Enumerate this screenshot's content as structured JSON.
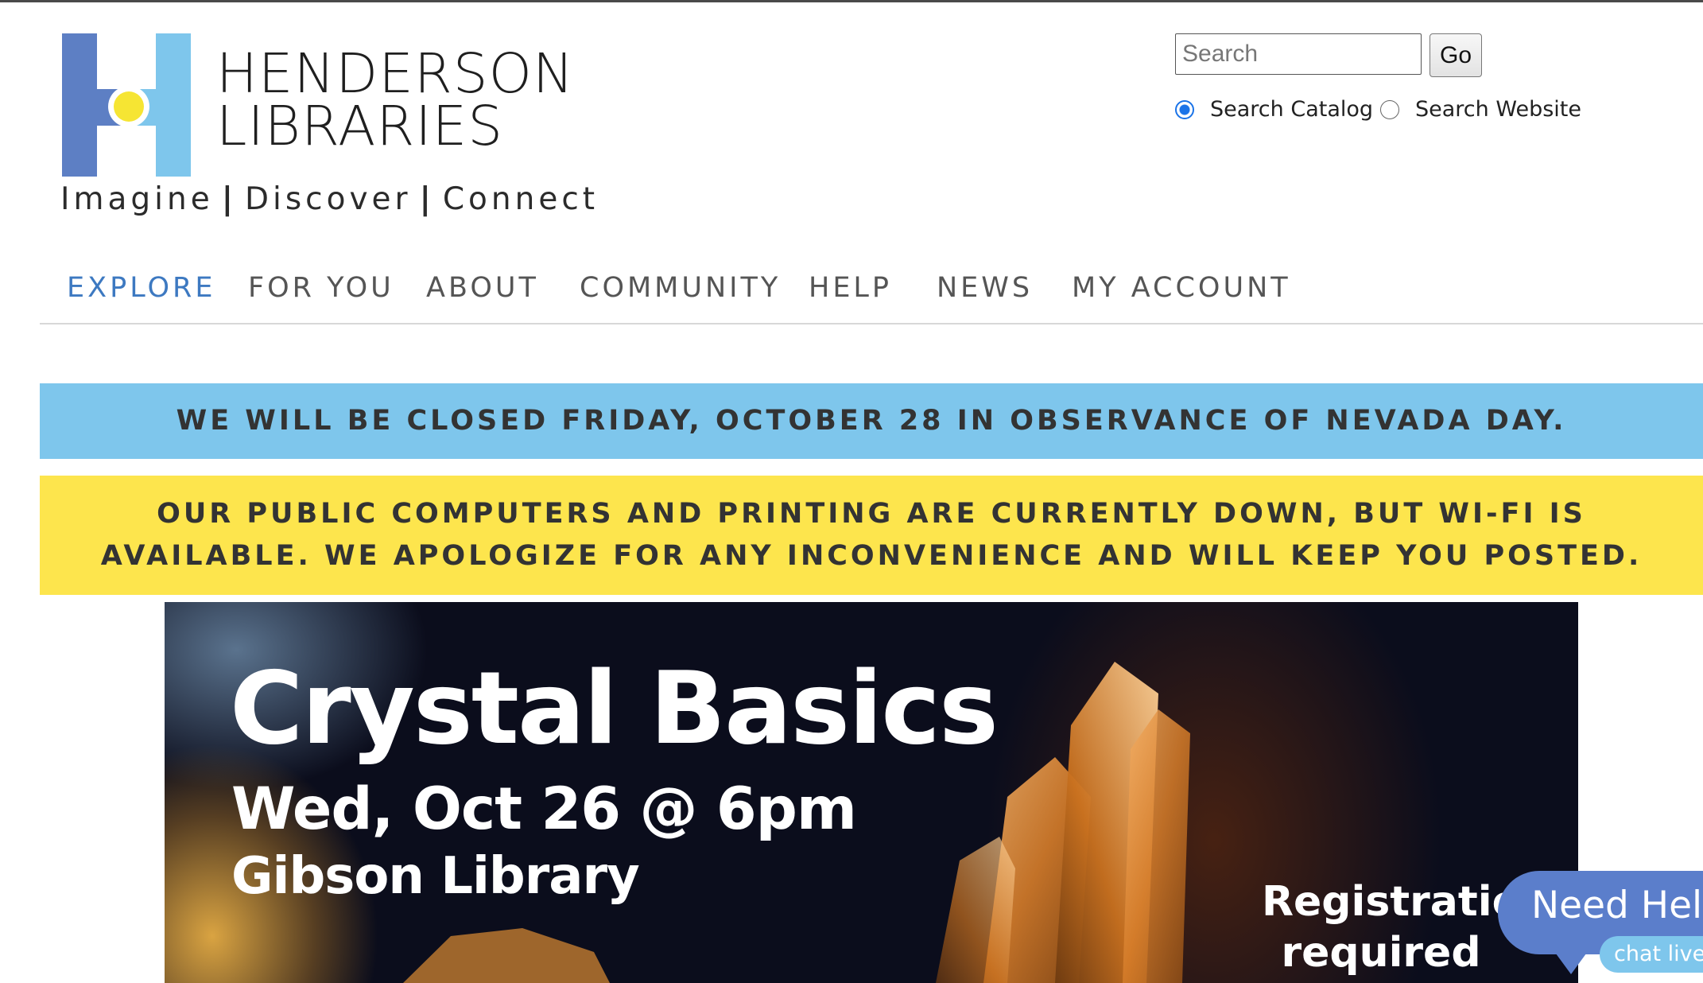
{
  "brand": {
    "name_line1": "HENDERSON",
    "name_line2": "LIBRARIES",
    "tagline": [
      "Imagine",
      "Discover",
      "Connect"
    ],
    "tagline_separator": "|",
    "colors": {
      "dark_blue": "#5d7fc4",
      "light_blue": "#7ec6ec",
      "yellow": "#fde54d"
    }
  },
  "search": {
    "placeholder": "Search",
    "value": "",
    "go_label": "Go",
    "options": [
      {
        "label": "Search Catalog",
        "selected": true
      },
      {
        "label": "Search Website",
        "selected": false
      }
    ]
  },
  "nav": {
    "items": [
      {
        "label": "EXPLORE",
        "active": true
      },
      {
        "label": "FOR YOU",
        "active": false
      },
      {
        "label": "ABOUT",
        "active": false
      },
      {
        "label": "COMMUNITY",
        "active": false
      },
      {
        "label": "HELP",
        "active": false
      },
      {
        "label": "NEWS",
        "active": false
      },
      {
        "label": "MY ACCOUNT",
        "active": false
      }
    ],
    "active_color": "#3d79c1"
  },
  "alerts": {
    "closure": "WE WILL BE CLOSED FRIDAY, OCTOBER 28 IN OBSERVANCE OF NEVADA DAY.",
    "computers": "OUR PUBLIC COMPUTERS AND PRINTING ARE CURRENTLY DOWN, BUT WI-FI IS AVAILABLE. WE APOLOGIZE FOR ANY INCONVENIENCE AND WILL KEEP YOU POSTED."
  },
  "hero": {
    "title": "Crystal Basics",
    "date": "Wed, Oct 26 @ 6pm",
    "location": "Gibson Library",
    "note_line1": "Registration",
    "note_line2": "required"
  },
  "chat": {
    "title": "Need Help",
    "subtitle": "chat live now"
  }
}
